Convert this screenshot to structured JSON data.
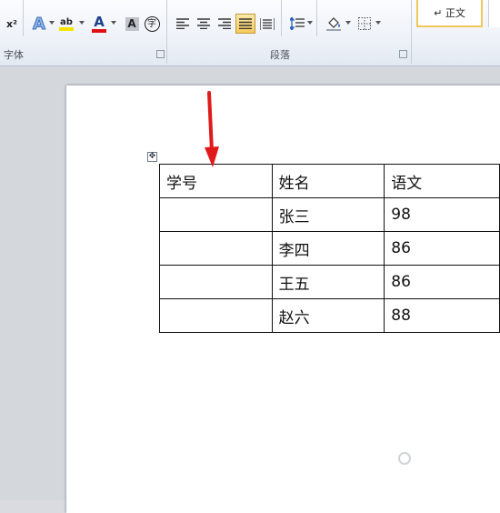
{
  "ribbon": {
    "font_group_label": "字体",
    "paragraph_group_label": "段落",
    "superscript_label": "x²",
    "text_effects_label": "A",
    "highlight_label": "ab",
    "font_color_label": "A",
    "char_shading_label": "A",
    "enclosed_char_label": "字",
    "style_normal_label": "↵ 正文",
    "highlight_color": "#f5e400",
    "font_color": "#e01010",
    "active_color": "#f8c95b"
  },
  "table": {
    "headers": [
      "学号",
      "姓名",
      "语文"
    ],
    "rows": [
      [
        "",
        "张三",
        "98"
      ],
      [
        "",
        "李四",
        "86"
      ],
      [
        "",
        "王五",
        "86"
      ],
      [
        "",
        "赵六",
        "88"
      ]
    ]
  },
  "annotation": {
    "arrow_color": "#e01a1a"
  }
}
